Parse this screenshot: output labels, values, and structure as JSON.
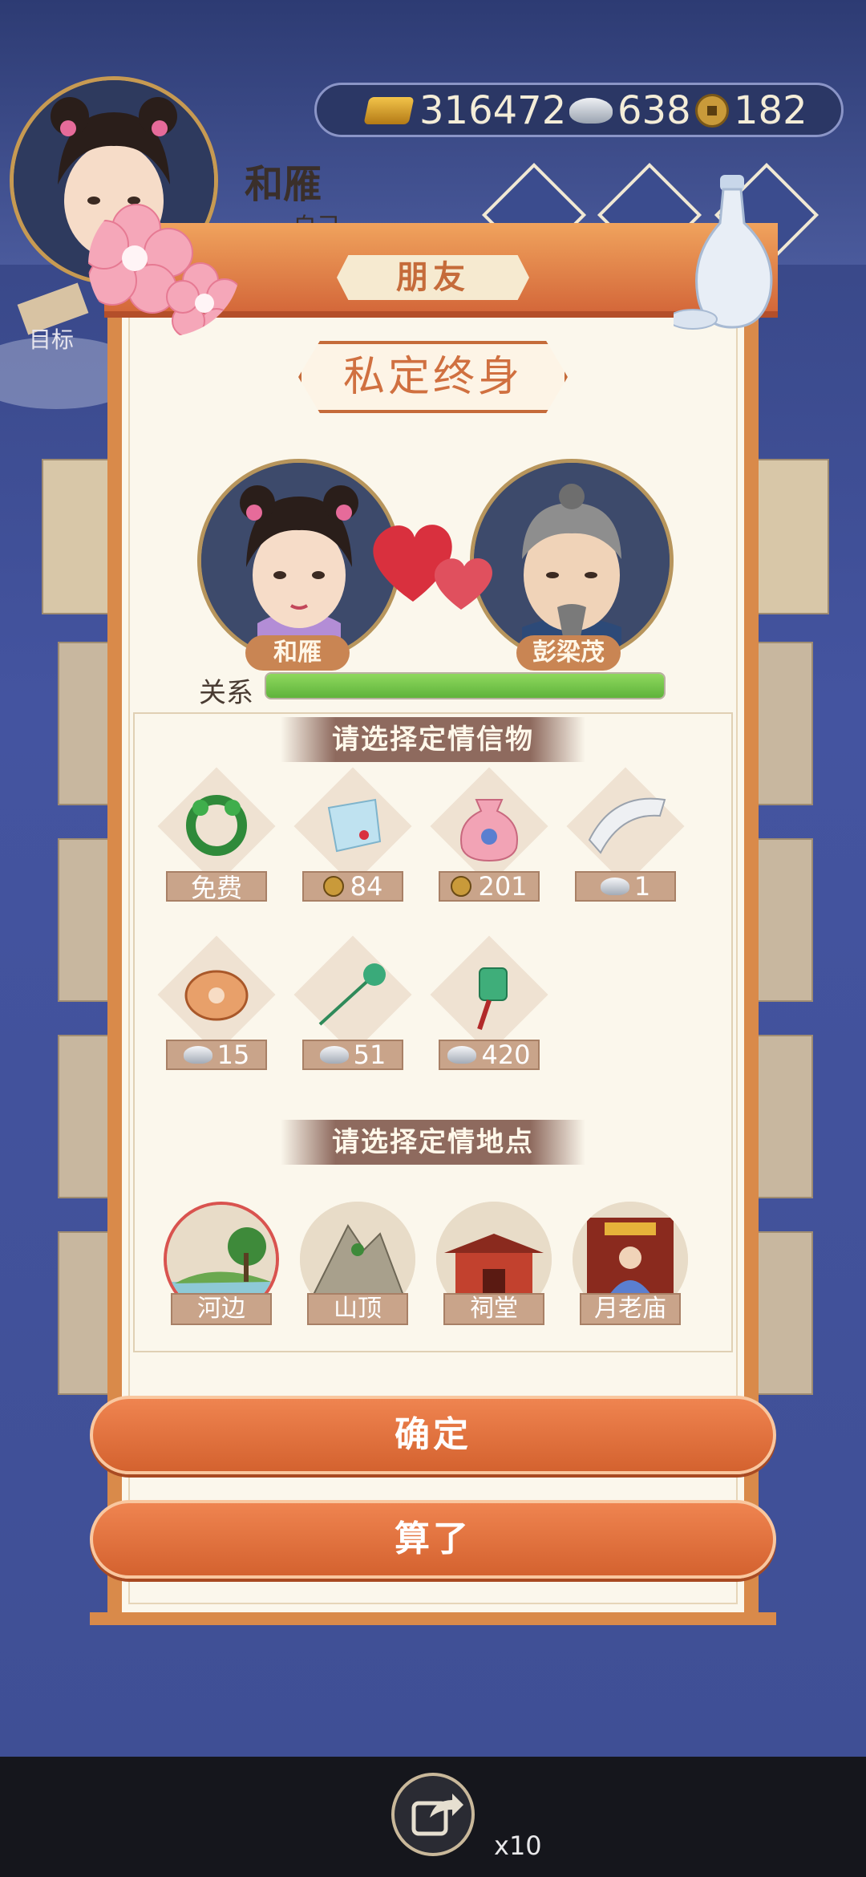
{
  "header": {
    "player_name": "和雁",
    "player_role": "自己",
    "gold": "316472",
    "silver": "638",
    "coins": "182",
    "goal_label": "目标"
  },
  "dialog": {
    "title": "朋友",
    "subtitle": "私定终身",
    "left_name": "和雁",
    "right_name": "彭梁茂",
    "relation_label": "关系",
    "relation_level": 1.0,
    "gifts_title": "请选择定情信物",
    "places_title": "请选择定情地点",
    "gifts": [
      {
        "name": "wreath",
        "price": "免费",
        "currency": "none"
      },
      {
        "name": "handkerchief",
        "price": "84",
        "currency": "coin"
      },
      {
        "name": "sachet",
        "price": "201",
        "currency": "coin"
      },
      {
        "name": "comb",
        "price": "1",
        "currency": "silver"
      },
      {
        "name": "jade-pendant",
        "price": "15",
        "currency": "silver"
      },
      {
        "name": "hairpin",
        "price": "51",
        "currency": "silver"
      },
      {
        "name": "jade-tassel",
        "price": "420",
        "currency": "silver"
      }
    ],
    "places": [
      {
        "label": "河边",
        "selected": true
      },
      {
        "label": "山顶",
        "selected": false
      },
      {
        "label": "祠堂",
        "selected": false
      },
      {
        "label": "月老庙",
        "selected": false
      }
    ],
    "confirm_label": "确定",
    "cancel_label": "算了"
  },
  "footer": {
    "share_count": "x10"
  },
  "colors": {
    "accent": "#d4622f",
    "relation_fill": "#5fb33b"
  }
}
